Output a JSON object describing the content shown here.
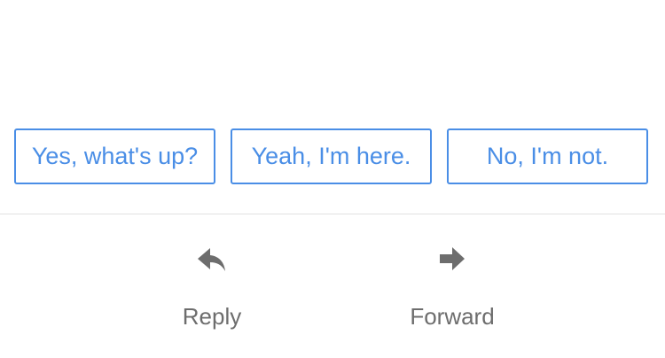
{
  "smart_replies": [
    {
      "label": "Yes, what's up?"
    },
    {
      "label": "Yeah, I'm here."
    },
    {
      "label": "No, I'm not."
    }
  ],
  "actions": {
    "reply": {
      "label": "Reply",
      "icon": "reply-arrow-icon"
    },
    "forward": {
      "label": "Forward",
      "icon": "forward-arrow-icon"
    }
  },
  "colors": {
    "accent": "#4a8ee6",
    "icon": "#6d6d6d",
    "divider": "#e1e1e1"
  }
}
